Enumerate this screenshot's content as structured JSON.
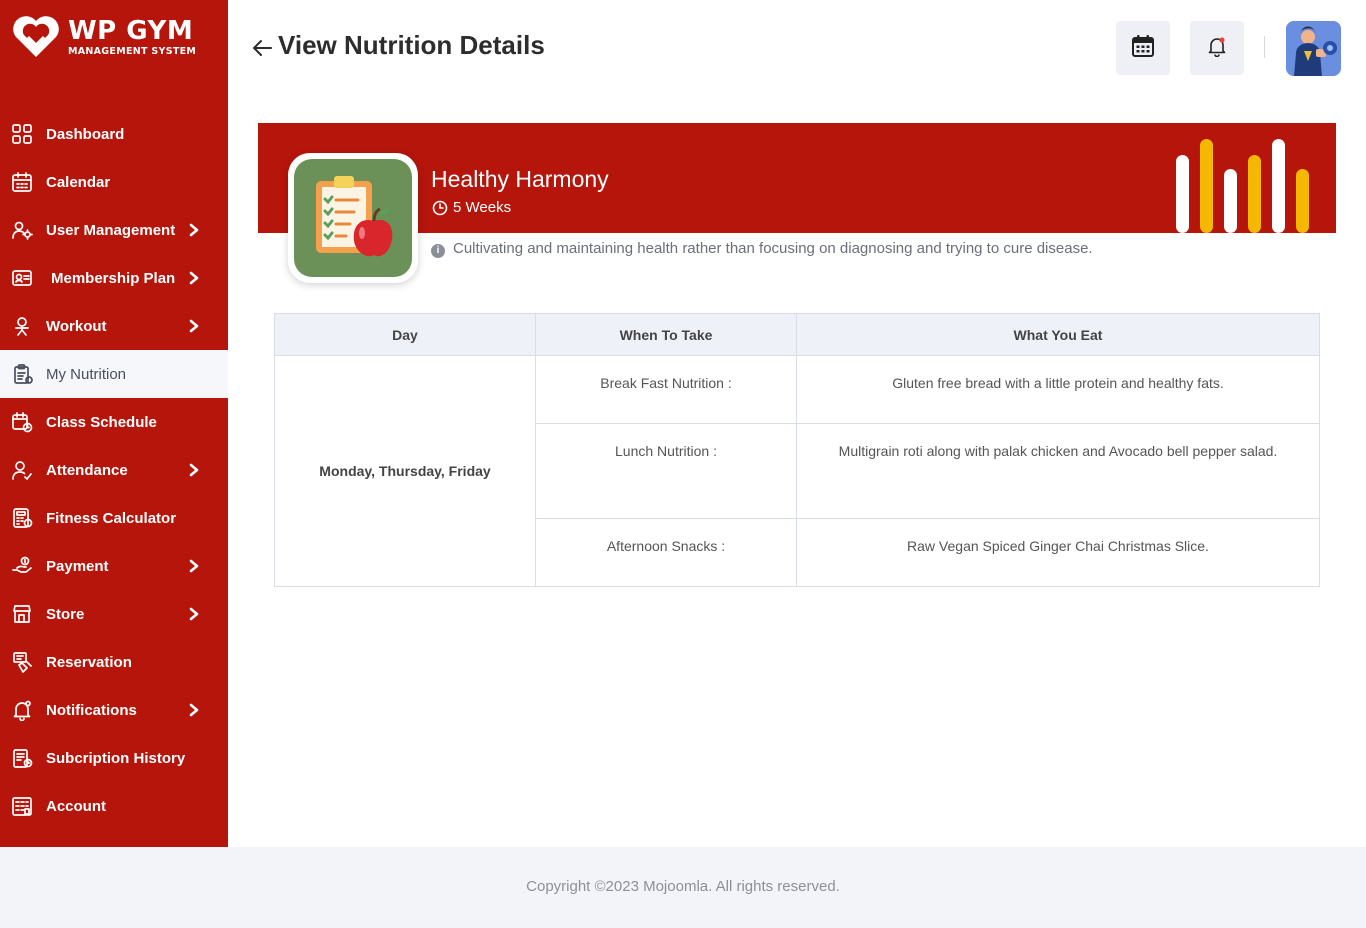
{
  "brand": {
    "title": "WP GYM",
    "subtitle": "MANAGEMENT SYSTEM"
  },
  "sidebar": {
    "items": [
      {
        "label": "Dashboard",
        "icon": "dashboard-grid-icon",
        "has_arrow": false,
        "active": false
      },
      {
        "label": "Calendar",
        "icon": "calendar-icon",
        "has_arrow": false,
        "active": false
      },
      {
        "label": "User Management",
        "icon": "users-gear-icon",
        "has_arrow": true,
        "active": false
      },
      {
        "label": "Membership Plan",
        "icon": "membership-card-icon",
        "has_arrow": true,
        "active": false
      },
      {
        "label": "Workout",
        "icon": "workout-icon",
        "has_arrow": true,
        "active": false
      },
      {
        "label": "My Nutrition",
        "icon": "nutrition-clipboard-icon",
        "has_arrow": false,
        "active": true
      },
      {
        "label": "Class Schedule",
        "icon": "class-schedule-icon",
        "has_arrow": false,
        "active": false
      },
      {
        "label": "Attendance",
        "icon": "attendance-user-icon",
        "has_arrow": true,
        "active": false
      },
      {
        "label": "Fitness Calculator",
        "icon": "calculator-icon",
        "has_arrow": false,
        "active": false
      },
      {
        "label": "Payment",
        "icon": "payment-hand-icon",
        "has_arrow": true,
        "active": false
      },
      {
        "label": "Store",
        "icon": "store-icon",
        "has_arrow": true,
        "active": false
      },
      {
        "label": "Reservation",
        "icon": "reservation-icon",
        "has_arrow": false,
        "active": false
      },
      {
        "label": "Notifications",
        "icon": "bell-icon",
        "has_arrow": true,
        "active": false
      },
      {
        "label": "Subcription History",
        "icon": "subscription-history-icon",
        "has_arrow": false,
        "active": false
      },
      {
        "label": "Account",
        "icon": "account-icon",
        "has_arrow": false,
        "active": false
      }
    ]
  },
  "header": {
    "title": "View Nutrition Details"
  },
  "plan": {
    "name": "Healthy Harmony",
    "duration": "5 Weeks",
    "description": "Cultivating and maintaining health rather than focusing on diagnosing and trying to cure disease."
  },
  "table": {
    "headers": [
      "Day",
      "When To Take",
      "What You Eat"
    ],
    "day": "Monday, Thursday, Friday",
    "rows": [
      {
        "when": "Break Fast Nutrition :",
        "what": "Gluten free bread with a little protein and healthy fats."
      },
      {
        "when": "Lunch Nutrition :",
        "what": "Multigrain roti along with palak chicken and Avocado bell pepper salad."
      },
      {
        "when": "Afternoon Snacks :",
        "what": "Raw Vegan Spiced Ginger Chai Christmas Slice."
      }
    ]
  },
  "footer": {
    "copyright": "Copyright ©2023 Mojoomla. All rights reserved."
  },
  "colors": {
    "brand_red": "#b5150b",
    "active_bg": "#f5f7fb",
    "bar_white": "#ffffff",
    "bar_yellow": "#f5b800"
  }
}
